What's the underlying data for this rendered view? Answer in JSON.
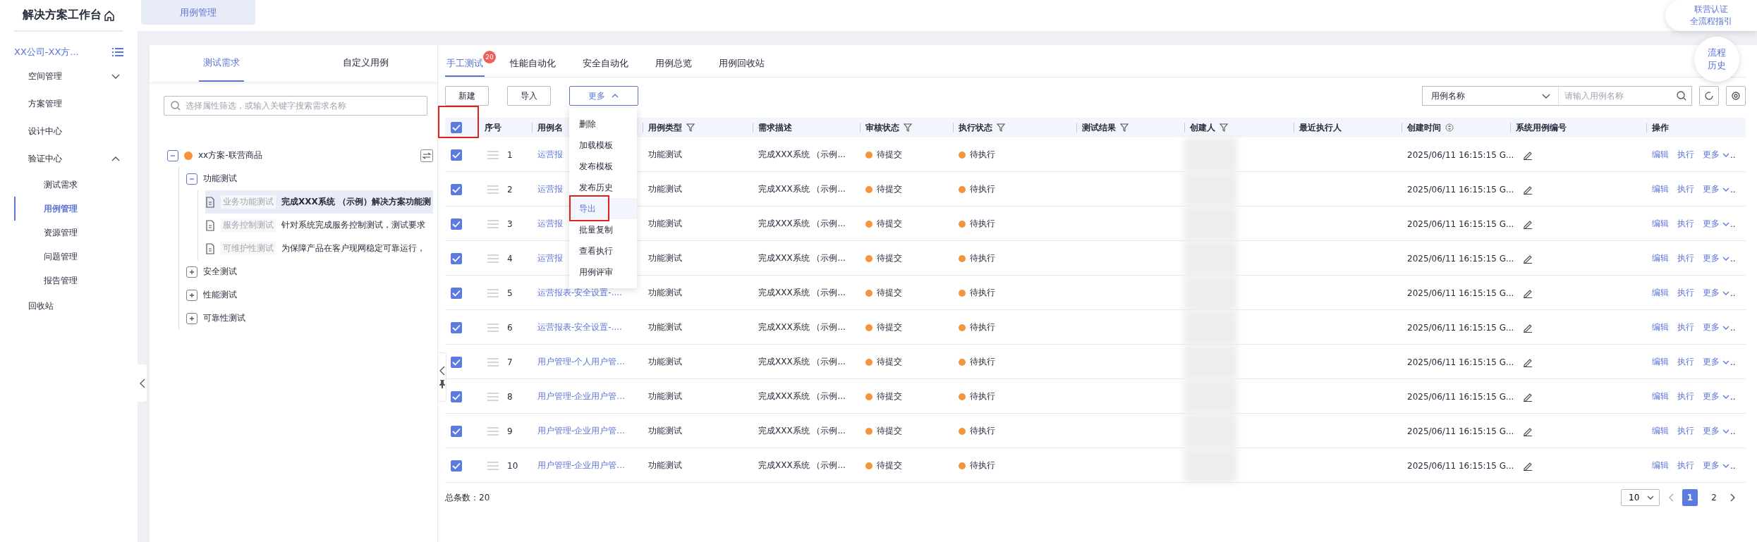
{
  "sidebar": {
    "title": "解决方案工作台",
    "workspace": "XX公司-XX方...",
    "items": [
      {
        "label": "空间管理",
        "expanded": false,
        "selected": false
      },
      {
        "label": "方案管理",
        "selected": false
      },
      {
        "label": "设计中心",
        "selected": false
      },
      {
        "label": "验证中心",
        "expanded": true,
        "selected": false,
        "children": [
          {
            "label": "测试需求",
            "selected": false
          },
          {
            "label": "用例管理",
            "selected": true
          },
          {
            "label": "资源管理",
            "selected": false
          },
          {
            "label": "问题管理",
            "selected": false
          },
          {
            "label": "报告管理",
            "selected": false
          }
        ]
      },
      {
        "label": "回收站",
        "selected": false
      }
    ]
  },
  "top_tabs": [
    {
      "label": "用例管理",
      "selected": true
    }
  ],
  "guide_button": {
    "lines": [
      "联营认证",
      "全流程指引"
    ]
  },
  "history_button": {
    "lines": [
      "流程",
      "历史"
    ]
  },
  "requirement_panel": {
    "tabs": [
      {
        "label": "测试需求",
        "selected": true
      },
      {
        "label": "自定义用例",
        "selected": false
      }
    ],
    "search": {
      "placeholder": "选择属性筛选，或输入关键字搜索需求名称"
    },
    "tree": [
      {
        "kind": "scheme",
        "label": "xx方案-联营商品",
        "expanded": true,
        "children": [
          {
            "kind": "group",
            "label": "功能测试",
            "expanded": true,
            "children": [
              {
                "kind": "requirement",
                "tag": "业务功能测试",
                "label": "完成XXX系统 （示例）解决方案功能测",
                "selected": true
              },
              {
                "kind": "requirement",
                "tag": "服务控制测试",
                "label": "针对系统完成服务控制测试，测试要求",
                "selected": false
              },
              {
                "kind": "requirement",
                "tag": "可维护性测试",
                "label": "为保障产品在客户现网稳定可靠运行，",
                "selected": false
              }
            ]
          },
          {
            "kind": "group",
            "label": "安全测试",
            "expanded": false
          },
          {
            "kind": "group",
            "label": "性能测试",
            "expanded": false
          },
          {
            "kind": "group",
            "label": "可靠性测试",
            "expanded": false
          }
        ]
      }
    ]
  },
  "case_panel": {
    "tabs": [
      {
        "label": "手工测试",
        "selected": true,
        "badge": "20"
      },
      {
        "label": "性能自动化",
        "selected": false
      },
      {
        "label": "安全自动化",
        "selected": false
      },
      {
        "label": "用例总览",
        "selected": false
      },
      {
        "label": "用例回收站",
        "selected": false
      }
    ],
    "buttons": [
      {
        "label": "新建"
      },
      {
        "label": "导入"
      },
      {
        "label": "更多",
        "expanded": true
      }
    ],
    "menu": [
      {
        "label": "删除",
        "hovered": false,
        "highlighted": false
      },
      {
        "label": "加载模板",
        "hovered": false,
        "highlighted": false
      },
      {
        "label": "发布模板",
        "hovered": false,
        "highlighted": false
      },
      {
        "label": "发布历史",
        "hovered": false,
        "highlighted": false
      },
      {
        "label": "导出",
        "hovered": true,
        "highlighted": true
      },
      {
        "label": "批量复制",
        "hovered": false,
        "highlighted": false
      },
      {
        "label": "查看执行",
        "hovered": false,
        "highlighted": false
      },
      {
        "label": "用例评审",
        "hovered": false,
        "highlighted": false
      }
    ],
    "filter": {
      "field": "用例名称",
      "placeholder": "请输入用例名称"
    },
    "table": {
      "all_checked": true,
      "all_highlighted": true,
      "columns": [
        {
          "label": "序号",
          "kind": "plain"
        },
        {
          "label": "用例名",
          "kind": "plain"
        },
        {
          "label": "用例类型",
          "kind": "filterable"
        },
        {
          "label": "需求描述",
          "kind": "plain"
        },
        {
          "label": "审核状态",
          "kind": "filterable"
        },
        {
          "label": "执行状态",
          "kind": "filterable"
        },
        {
          "label": "测试结果",
          "kind": "filterable"
        },
        {
          "label": "创建人",
          "kind": "filterable"
        },
        {
          "label": "最近执行人",
          "kind": "plain"
        },
        {
          "label": "创建时间",
          "kind": "sortable"
        },
        {
          "label": "系统用例编号",
          "kind": "plain"
        },
        {
          "label": "操作",
          "kind": "plain"
        }
      ],
      "rows": [
        {
          "checked": true,
          "index": "1",
          "name": "运营报",
          "type": "功能测试",
          "description": "完成XXX系统 （示例...",
          "review": {
            "text": "待提交",
            "color": "#f5953b"
          },
          "execution": {
            "text": "待执行",
            "color": "#f5953b"
          },
          "created": "2025/06/11 16:15:15 G...",
          "actions": [
            "编辑",
            "执行",
            "更多"
          ],
          "overflow": ".."
        },
        {
          "checked": true,
          "index": "2",
          "name": "运营报",
          "type": "功能测试",
          "description": "完成XXX系统 （示例...",
          "review": {
            "text": "待提交",
            "color": "#f5953b"
          },
          "execution": {
            "text": "待执行",
            "color": "#f5953b"
          },
          "created": "2025/06/11 16:15:15 G...",
          "actions": [
            "编辑",
            "执行",
            "更多"
          ],
          "overflow": ".."
        },
        {
          "checked": true,
          "index": "3",
          "name": "运营报",
          "type": "功能测试",
          "description": "完成XXX系统 （示例...",
          "review": {
            "text": "待提交",
            "color": "#f5953b"
          },
          "execution": {
            "text": "待执行",
            "color": "#f5953b"
          },
          "created": "2025/06/11 16:15:15 G...",
          "actions": [
            "编辑",
            "执行",
            "更多"
          ],
          "overflow": ".."
        },
        {
          "checked": true,
          "index": "4",
          "name": "运营报",
          "type": "功能测试",
          "description": "完成XXX系统 （示例...",
          "review": {
            "text": "待提交",
            "color": "#f5953b"
          },
          "execution": {
            "text": "待执行",
            "color": "#f5953b"
          },
          "created": "2025/06/11 16:15:15 G...",
          "actions": [
            "编辑",
            "执行",
            "更多"
          ],
          "overflow": ".."
        },
        {
          "checked": true,
          "index": "5",
          "name": "运营报表-安全设置-....",
          "type": "功能测试",
          "description": "完成XXX系统 （示例...",
          "review": {
            "text": "待提交",
            "color": "#f5953b"
          },
          "execution": {
            "text": "待执行",
            "color": "#f5953b"
          },
          "created": "2025/06/11 16:15:15 G...",
          "actions": [
            "编辑",
            "执行",
            "更多"
          ],
          "overflow": ".."
        },
        {
          "checked": true,
          "index": "6",
          "name": "运营报表-安全设置-....",
          "type": "功能测试",
          "description": "完成XXX系统 （示例...",
          "review": {
            "text": "待提交",
            "color": "#f5953b"
          },
          "execution": {
            "text": "待执行",
            "color": "#f5953b"
          },
          "created": "2025/06/11 16:15:15 G...",
          "actions": [
            "编辑",
            "执行",
            "更多"
          ],
          "overflow": ".."
        },
        {
          "checked": true,
          "index": "7",
          "name": "用户管理-个人用户管...",
          "type": "功能测试",
          "description": "完成XXX系统 （示例...",
          "review": {
            "text": "待提交",
            "color": "#f5953b"
          },
          "execution": {
            "text": "待执行",
            "color": "#f5953b"
          },
          "created": "2025/06/11 16:15:15 G...",
          "actions": [
            "编辑",
            "执行",
            "更多"
          ],
          "overflow": ".."
        },
        {
          "checked": true,
          "index": "8",
          "name": "用户管理-企业用户管...",
          "type": "功能测试",
          "description": "完成XXX系统 （示例...",
          "review": {
            "text": "待提交",
            "color": "#f5953b"
          },
          "execution": {
            "text": "待执行",
            "color": "#f5953b"
          },
          "created": "2025/06/11 16:15:15 G...",
          "actions": [
            "编辑",
            "执行",
            "更多"
          ],
          "overflow": ".."
        },
        {
          "checked": true,
          "index": "9",
          "name": "用户管理-企业用户管...",
          "type": "功能测试",
          "description": "完成XXX系统 （示例...",
          "review": {
            "text": "待提交",
            "color": "#f5953b"
          },
          "execution": {
            "text": "待执行",
            "color": "#f5953b"
          },
          "created": "2025/06/11 16:15:15 G...",
          "actions": [
            "编辑",
            "执行",
            "更多"
          ],
          "overflow": ".."
        },
        {
          "checked": true,
          "index": "10",
          "name": "用户管理-企业用户管...",
          "type": "功能测试",
          "description": "完成XXX系统 （示例...",
          "review": {
            "text": "待提交",
            "color": "#f5953b"
          },
          "execution": {
            "text": "待执行",
            "color": "#f5953b"
          },
          "created": "2025/06/11 16:15:15 G...",
          "actions": [
            "编辑",
            "执行",
            "更多"
          ],
          "overflow": ".."
        }
      ]
    },
    "total": "总条数：20",
    "pagination": {
      "page_size": "10",
      "pages": [
        {
          "label": "1",
          "selected": true
        },
        {
          "label": "2",
          "selected": false
        }
      ]
    }
  }
}
